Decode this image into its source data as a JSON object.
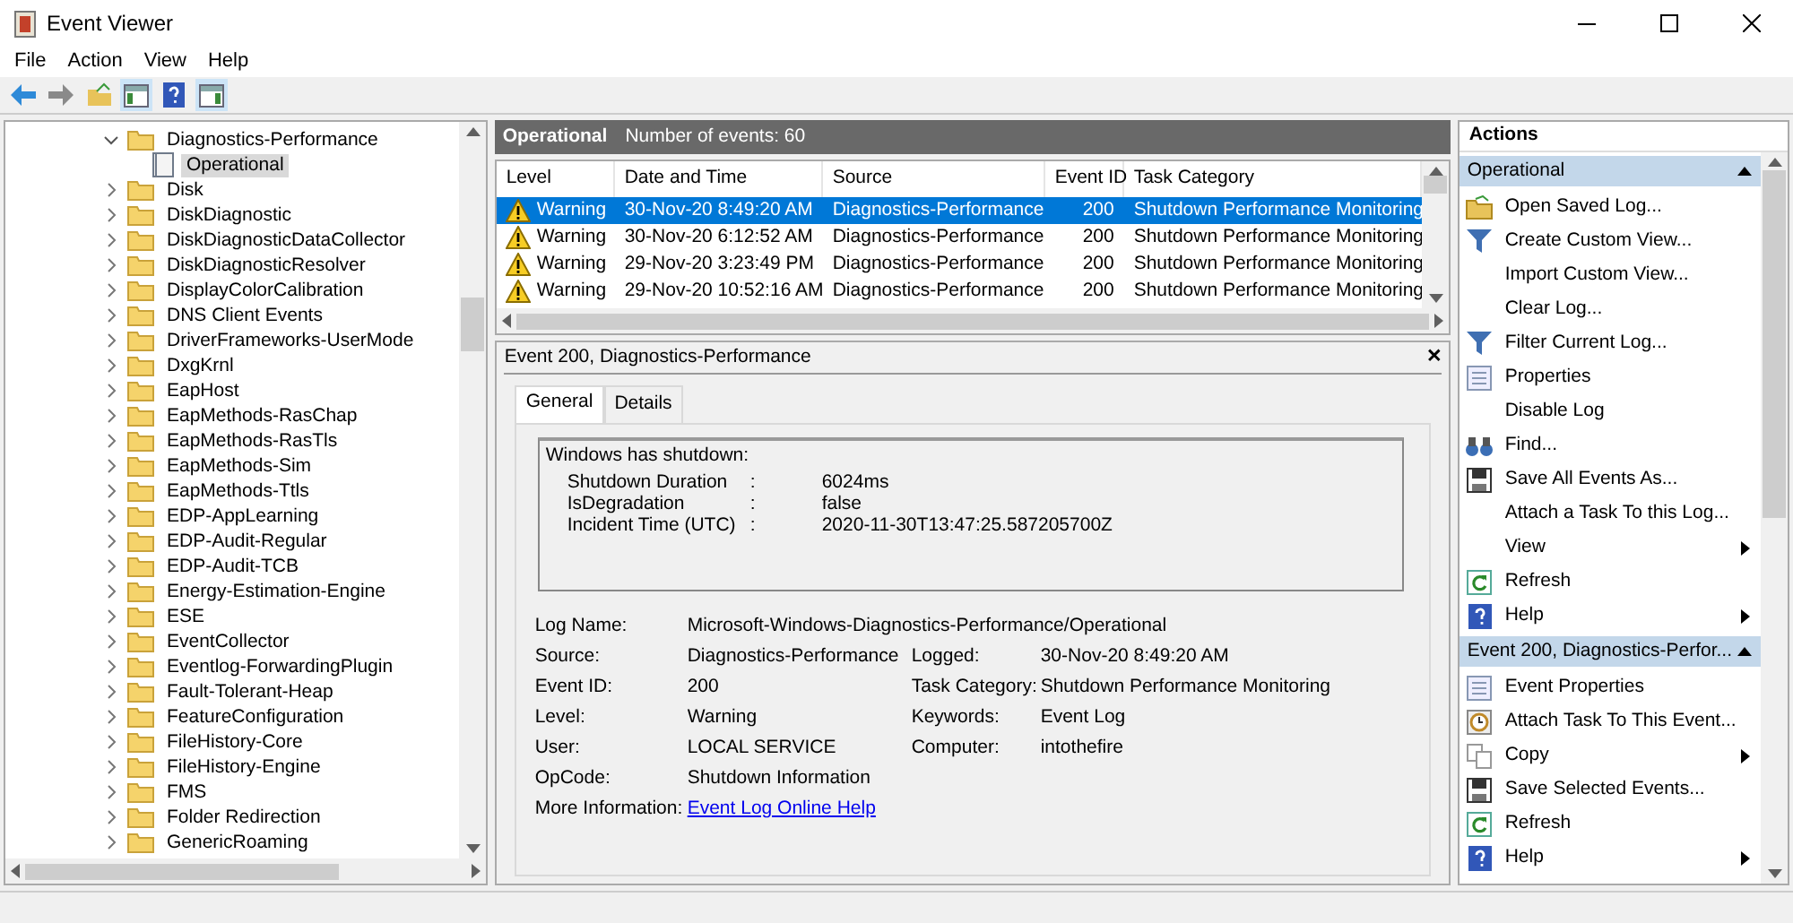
{
  "window": {
    "title": "Event Viewer"
  },
  "menu": [
    "File",
    "Action",
    "View",
    "Help"
  ],
  "tree": {
    "parent": {
      "label": "Diagnostics-Performance",
      "expanded": true,
      "children": [
        {
          "label": "Operational",
          "selected": true
        }
      ]
    },
    "items": [
      {
        "label": "Disk",
        "expanded": false
      },
      {
        "label": "DiskDiagnostic",
        "expanded": false
      },
      {
        "label": "DiskDiagnosticDataCollector",
        "expanded": false
      },
      {
        "label": "DiskDiagnosticResolver",
        "expanded": false
      },
      {
        "label": "DisplayColorCalibration",
        "expanded": false
      },
      {
        "label": "DNS Client Events",
        "expanded": false
      },
      {
        "label": "DriverFrameworks-UserMode",
        "expanded": false
      },
      {
        "label": "DxgKrnl",
        "expanded": false
      },
      {
        "label": "EapHost",
        "expanded": false
      },
      {
        "label": "EapMethods-RasChap",
        "expanded": false
      },
      {
        "label": "EapMethods-RasTls",
        "expanded": false
      },
      {
        "label": "EapMethods-Sim",
        "expanded": false
      },
      {
        "label": "EapMethods-Ttls",
        "expanded": false
      },
      {
        "label": "EDP-AppLearning",
        "expanded": false
      },
      {
        "label": "EDP-Audit-Regular",
        "expanded": false
      },
      {
        "label": "EDP-Audit-TCB",
        "expanded": false
      },
      {
        "label": "Energy-Estimation-Engine",
        "expanded": false
      },
      {
        "label": "ESE",
        "expanded": false
      },
      {
        "label": "EventCollector",
        "expanded": false
      },
      {
        "label": "Eventlog-ForwardingPlugin",
        "expanded": false
      },
      {
        "label": "Fault-Tolerant-Heap",
        "expanded": false
      },
      {
        "label": "FeatureConfiguration",
        "expanded": false
      },
      {
        "label": "FileHistory-Core",
        "expanded": false
      },
      {
        "label": "FileHistory-Engine",
        "expanded": false
      },
      {
        "label": "FMS",
        "expanded": false
      },
      {
        "label": "Folder Redirection",
        "expanded": false
      },
      {
        "label": "GenericRoaming",
        "expanded": false
      }
    ]
  },
  "log_header": {
    "title": "Operational",
    "count": "Number of events: 60"
  },
  "events": {
    "columns": [
      "Level",
      "Date and Time",
      "Source",
      "Event ID",
      "Task Category"
    ],
    "rows": [
      {
        "level": "Warning",
        "date": "30-Nov-20 8:49:20 AM",
        "source": "Diagnostics-Performance",
        "event_id": "200",
        "task": "Shutdown Performance Monitoring",
        "selected": true
      },
      {
        "level": "Warning",
        "date": "30-Nov-20 6:12:52 AM",
        "source": "Diagnostics-Performance",
        "event_id": "200",
        "task": "Shutdown Performance Monitoring",
        "selected": false
      },
      {
        "level": "Warning",
        "date": "29-Nov-20 3:23:49 PM",
        "source": "Diagnostics-Performance",
        "event_id": "200",
        "task": "Shutdown Performance Monitoring",
        "selected": false
      },
      {
        "level": "Warning",
        "date": "29-Nov-20 10:52:16 AM",
        "source": "Diagnostics-Performance",
        "event_id": "200",
        "task": "Shutdown Performance Monitoring",
        "selected": false
      }
    ]
  },
  "detail": {
    "title": "Event 200, Diagnostics-Performance",
    "close": "✕",
    "tabs": [
      {
        "label": "General",
        "selected": true
      },
      {
        "label": "Details",
        "selected": false
      }
    ],
    "description": {
      "heading": "Windows has shutdown:",
      "lines": [
        {
          "label": "Shutdown Duration",
          "sep": ":",
          "value": "6024ms"
        },
        {
          "label": "IsDegradation",
          "sep": ":",
          "value": "false"
        },
        {
          "label": "Incident Time (UTC)",
          "sep": ":",
          "value": "2020-11-30T13:47:25.587205700Z"
        }
      ]
    },
    "log_name": {
      "label": "Log Name:",
      "value": "Microsoft-Windows-Diagnostics-Performance/Operational"
    },
    "fields": [
      [
        {
          "label": "Source:",
          "value": "Diagnostics-Performance"
        },
        {
          "label": "Logged:",
          "value": "30-Nov-20 8:49:20 AM"
        }
      ],
      [
        {
          "label": "Event ID:",
          "value": "200"
        },
        {
          "label": "Task Category:",
          "value": "Shutdown Performance Monitoring"
        }
      ],
      [
        {
          "label": "Level:",
          "value": "Warning"
        },
        {
          "label": "Keywords:",
          "value": "Event Log"
        }
      ],
      [
        {
          "label": "User:",
          "value": "LOCAL SERVICE"
        },
        {
          "label": "Computer:",
          "value": "intothefire"
        }
      ],
      [
        {
          "label": "OpCode:",
          "value": "Shutdown Information"
        }
      ]
    ],
    "more_info": {
      "label": "More Information:",
      "link": "Event Log Online Help"
    }
  },
  "actions": {
    "title": "Actions",
    "sections": [
      {
        "title": "Operational",
        "expanded": true,
        "items": [
          {
            "label": "Open Saved Log...",
            "kind": "folder",
            "submenu": false
          },
          {
            "label": "Create Custom View...",
            "kind": "funnel",
            "submenu": false
          },
          {
            "label": "Import Custom View...",
            "kind": "plain",
            "submenu": false
          },
          {
            "label": "Clear Log...",
            "kind": "plain",
            "submenu": false
          },
          {
            "label": "Filter Current Log...",
            "kind": "funnel",
            "submenu": false
          },
          {
            "label": "Properties",
            "kind": "sheet",
            "submenu": false
          },
          {
            "label": "Disable Log",
            "kind": "plain",
            "submenu": false
          },
          {
            "label": "Find...",
            "kind": "find",
            "submenu": false
          },
          {
            "label": "Save All Events As...",
            "kind": "save",
            "submenu": false
          },
          {
            "label": "Attach a Task To this Log...",
            "kind": "plain",
            "submenu": false
          },
          {
            "label": "View",
            "kind": "plain",
            "submenu": true
          },
          {
            "label": "Refresh",
            "kind": "refresh",
            "submenu": false
          },
          {
            "label": "Help",
            "kind": "help",
            "submenu": true
          }
        ]
      },
      {
        "title": "Event 200, Diagnostics-Perfor...",
        "expanded": true,
        "items": [
          {
            "label": "Event Properties",
            "kind": "sheet",
            "submenu": false
          },
          {
            "label": "Attach Task To This Event...",
            "kind": "clock",
            "submenu": false
          },
          {
            "label": "Copy",
            "kind": "copy",
            "submenu": true
          },
          {
            "label": "Save Selected Events...",
            "kind": "save",
            "submenu": false
          },
          {
            "label": "Refresh",
            "kind": "refresh",
            "submenu": false
          },
          {
            "label": "Help",
            "kind": "help",
            "submenu": true
          }
        ]
      }
    ]
  }
}
